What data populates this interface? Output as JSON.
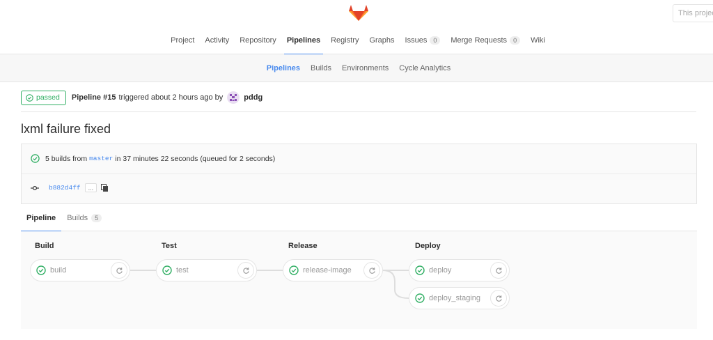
{
  "header": {
    "search_placeholder": "This project"
  },
  "main_nav": [
    {
      "label": "Project"
    },
    {
      "label": "Activity"
    },
    {
      "label": "Repository"
    },
    {
      "label": "Pipelines",
      "active": true
    },
    {
      "label": "Registry"
    },
    {
      "label": "Graphs"
    },
    {
      "label": "Issues",
      "count": "0"
    },
    {
      "label": "Merge Requests",
      "count": "0"
    },
    {
      "label": "Wiki"
    }
  ],
  "sub_nav": [
    {
      "label": "Pipelines",
      "active": true
    },
    {
      "label": "Builds"
    },
    {
      "label": "Environments"
    },
    {
      "label": "Cycle Analytics"
    }
  ],
  "pipeline": {
    "status": "passed",
    "name": "Pipeline #15",
    "trigger_text": "triggered about 2 hours ago by",
    "user": "pddg",
    "title": "lxml failure fixed",
    "summary_prefix": "5 builds from",
    "branch": "master",
    "summary_suffix": "in 37 minutes 22 seconds (queued for 2 seconds)",
    "sha": "b882d4ff",
    "ellipsis": "..."
  },
  "tabs": [
    {
      "label": "Pipeline",
      "active": true
    },
    {
      "label": "Builds",
      "count": "5"
    }
  ],
  "stages": [
    {
      "title": "Build",
      "jobs": [
        {
          "name": "build"
        }
      ]
    },
    {
      "title": "Test",
      "jobs": [
        {
          "name": "test"
        }
      ]
    },
    {
      "title": "Release",
      "jobs": [
        {
          "name": "release-image"
        }
      ]
    },
    {
      "title": "Deploy",
      "jobs": [
        {
          "name": "deploy"
        },
        {
          "name": "deploy_staging"
        }
      ]
    }
  ],
  "colors": {
    "success": "#31af64",
    "accent": "#4a8bee"
  },
  "icons": {
    "logo": "gitlab-tanuki-icon",
    "status": "check-circle-icon",
    "retry": "retry-icon",
    "commit": "commit-icon",
    "copy": "clipboard-icon"
  }
}
